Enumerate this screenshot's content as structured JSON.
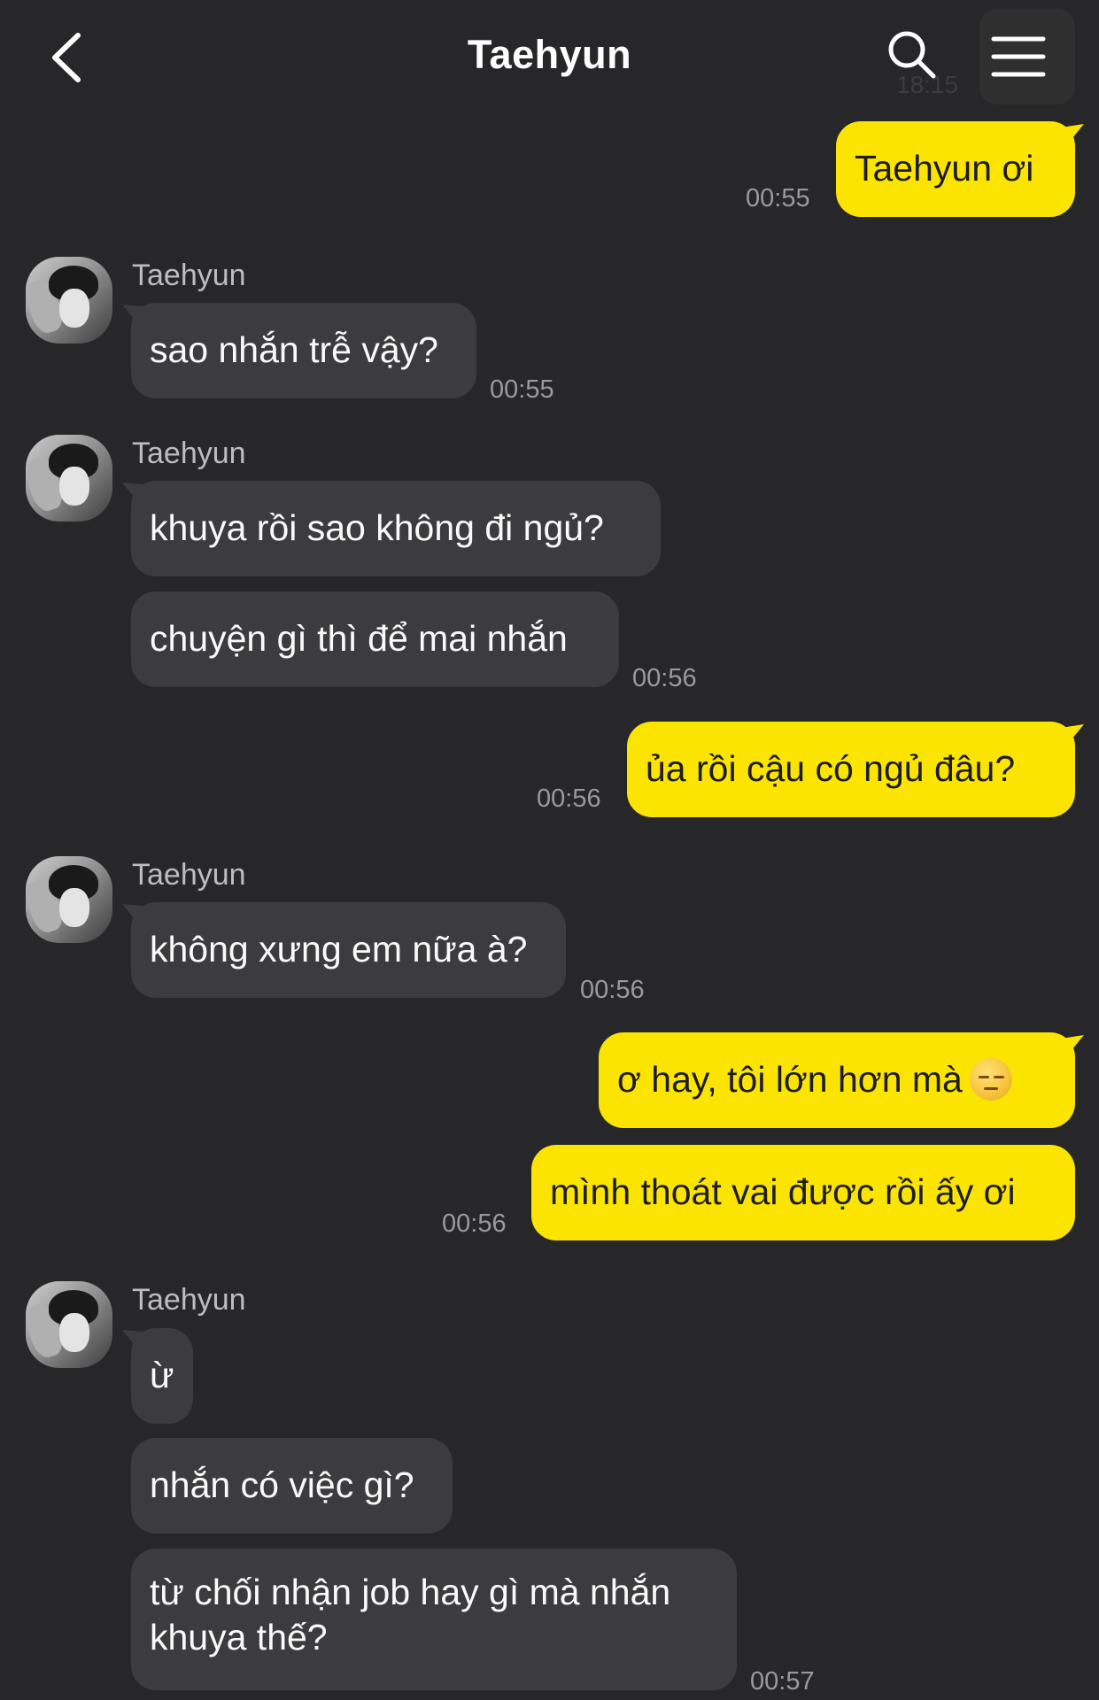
{
  "header": {
    "title": "Taehyun",
    "back_icon": "chevron-left-icon",
    "search_icon": "search-icon",
    "menu_icon": "hamburger-menu-icon",
    "status_time_ghost": "18:15"
  },
  "colors": {
    "background": "#272729",
    "incoming_bubble": "#3c3c3e",
    "outgoing_bubble": "#fbe500",
    "timestamp": "#9a9a9e"
  },
  "messages": [
    {
      "from": "me",
      "text": "Taehyun ơi",
      "time": "00:55"
    },
    {
      "from": "Taehyun",
      "sender": "Taehyun",
      "text": "sao nhắn trễ vậy?",
      "time": "00:55"
    },
    {
      "from": "Taehyun",
      "sender": "Taehyun",
      "text": "khuya rồi sao không đi ngủ?"
    },
    {
      "from": "Taehyun",
      "text": "chuyện gì thì để mai nhắn",
      "time": "00:56"
    },
    {
      "from": "me",
      "text": "ủa rồi cậu có ngủ đâu?",
      "time": "00:56"
    },
    {
      "from": "Taehyun",
      "sender": "Taehyun",
      "text": "không xưng em nữa à?",
      "time": "00:56"
    },
    {
      "from": "me",
      "text": "ơ hay, tôi lớn hơn mà",
      "emoji": "pensive-face-emoji"
    },
    {
      "from": "me",
      "text": "mình thoát vai được rồi ấy ơi",
      "time": "00:56"
    },
    {
      "from": "Taehyun",
      "sender": "Taehyun",
      "text": "ừ"
    },
    {
      "from": "Taehyun",
      "text": "nhắn có việc gì?"
    },
    {
      "from": "Taehyun",
      "text_line1": "từ chối nhận job hay gì mà nhắn",
      "text_line2": "khuya thế?",
      "time": "00:57"
    }
  ]
}
